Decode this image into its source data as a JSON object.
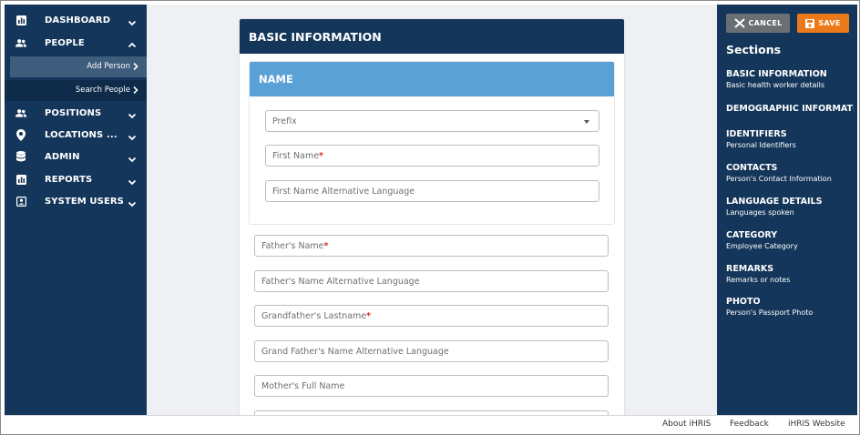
{
  "sidebar": {
    "items": [
      {
        "label": "DASHBOARD",
        "icon": "chart-icon"
      },
      {
        "label": "PEOPLE",
        "icon": "people-icon"
      },
      {
        "label": "POSITIONS",
        "icon": "people-icon"
      },
      {
        "label": "LOCATIONS ...",
        "icon": "location-pin-icon"
      },
      {
        "label": "ADMIN",
        "icon": "database-icon"
      },
      {
        "label": "REPORTS",
        "icon": "chart-icon"
      },
      {
        "label": "SYSTEM USERS",
        "icon": "id-card-icon"
      }
    ],
    "people_sub": {
      "add_person": "Add Person",
      "search_people": "Search People"
    }
  },
  "form": {
    "section_title": "BASIC INFORMATION",
    "name_header": "NAME",
    "prefix_placeholder": "Prefix",
    "first_name": "First Name",
    "first_name_alt": "First Name Alternative Language",
    "fathers_name": "Father's Name",
    "fathers_name_alt": "Father's Name Alternative Language",
    "grandfathers_lastname": "Grandfather's Lastname",
    "grandfathers_name_alt": "Grand Father's Name Alternative Language",
    "mothers_full_name": "Mother's Full Name",
    "required_mark": "*"
  },
  "toolbar": {
    "cancel_label": "CANCEL",
    "save_label": "SAVE"
  },
  "sections": {
    "title": "Sections",
    "items": [
      {
        "title": "BASIC INFORMATION",
        "desc": "Basic health worker details"
      },
      {
        "title": "DEMOGRAPHIC INFORMATIC",
        "desc": ""
      },
      {
        "title": "IDENTIFIERS",
        "desc": "Personal Identifiers"
      },
      {
        "title": "CONTACTS",
        "desc": "Person's Contact Information"
      },
      {
        "title": "LANGUAGE DETAILS",
        "desc": "Languages spoken"
      },
      {
        "title": "CATEGORY",
        "desc": "Employee Category"
      },
      {
        "title": "REMARKS",
        "desc": "Remarks or notes"
      },
      {
        "title": "PHOTO",
        "desc": "Person's Passport Photo"
      }
    ]
  },
  "footer": {
    "about": "About iHRIS",
    "feedback": "Feedback",
    "website": "iHRIS Website"
  },
  "colors": {
    "sidebar_bg": "#14365a",
    "name_header_bg": "#5aa2d6",
    "save_button": "#ec7a1a",
    "cancel_button": "#6a6f74",
    "required": "#d32f2f"
  }
}
